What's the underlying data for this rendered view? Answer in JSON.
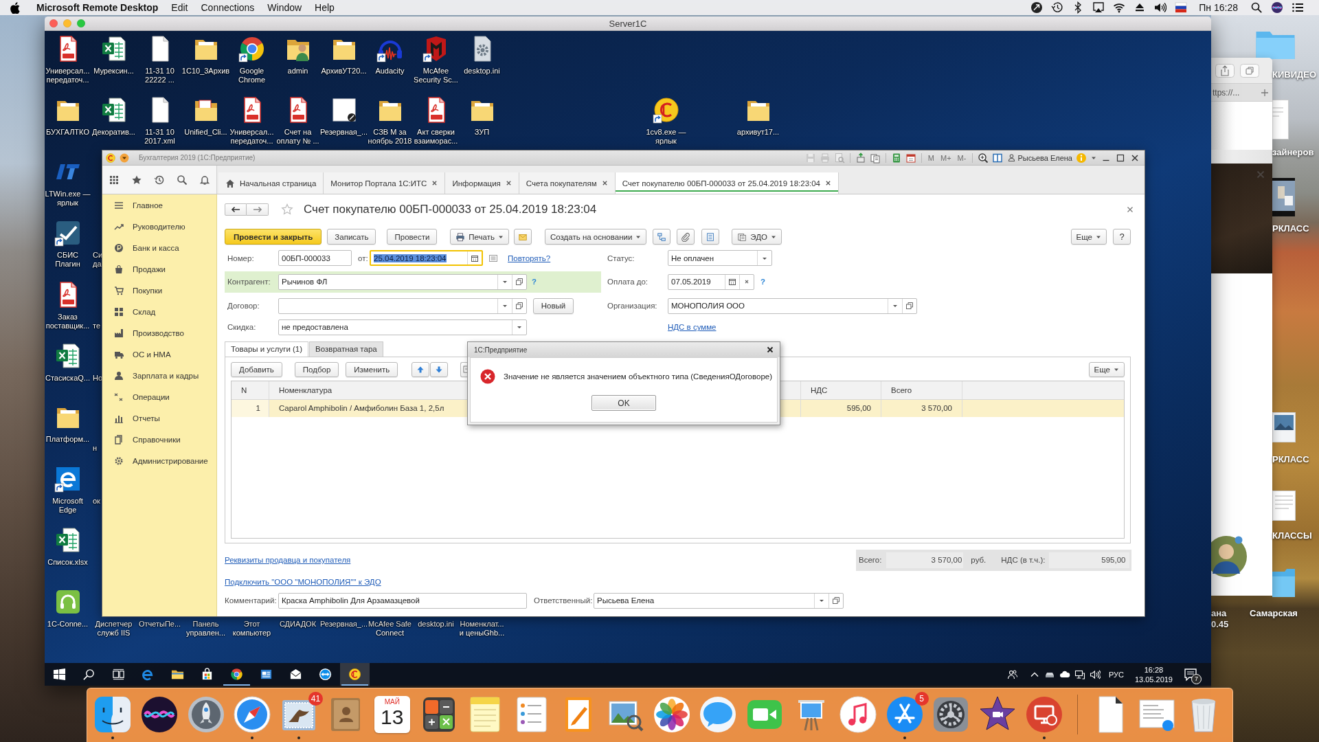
{
  "menu_bar": {
    "app_name": "Microsoft Remote Desktop",
    "menus": [
      "Edit",
      "Connections",
      "Window",
      "Help"
    ],
    "clock": "Пн 16:28"
  },
  "mac_desktop": {
    "browser_address": "ttps://...",
    "labels": [
      "КИВИДЕО",
      "зайнеров",
      "РКЛАСС",
      "РКЛАСС",
      "КЛАССЫ",
      "ана\n0.45",
      "Самарская"
    ]
  },
  "remote_window": {
    "title": "Server1C"
  },
  "remote_desktop": {
    "icons": [
      {
        "label": "Универсал...\nпередаточ...",
        "kind": "pdf",
        "shortcut": false
      },
      {
        "label": "Мурексин...",
        "kind": "excel",
        "shortcut": false
      },
      {
        "label": "11-31 10\n22222 ...",
        "kind": "file",
        "shortcut": false
      },
      {
        "label": "1С10_3Архив",
        "kind": "folder",
        "shortcut": false
      },
      {
        "label": "Google\nChrome",
        "kind": "chrome",
        "shortcut": true
      },
      {
        "label": "admin",
        "kind": "user",
        "shortcut": false
      },
      {
        "label": "АрхивУТ20...",
        "kind": "folder",
        "shortcut": false
      },
      {
        "label": "Audacity",
        "kind": "audio",
        "shortcut": true
      },
      {
        "label": "McAfee\nSecurity Sc...",
        "kind": "mcafee",
        "shortcut": true
      },
      {
        "label": "desktop.ini",
        "kind": "gearfile",
        "shortcut": false
      },
      {
        "label": "БУХГАЛТКО",
        "kind": "folder",
        "shortcut": false
      },
      {
        "label": "Декоратив...",
        "kind": "excel",
        "shortcut": false
      },
      {
        "label": "11-31 10\n2017.xml",
        "kind": "file",
        "shortcut": false
      },
      {
        "label": "Unified_Cli...",
        "kind": "docfolder",
        "shortcut": false
      },
      {
        "label": "Универсал...\nпередаточ...",
        "kind": "pdf",
        "shortcut": false
      },
      {
        "label": "Счет на\nоплату № ...",
        "kind": "pdf",
        "shortcut": false
      },
      {
        "label": "Резервная_...",
        "kind": "image",
        "shortcut": false
      },
      {
        "label": "СЗВ М за\nноябрь 2018",
        "kind": "folder",
        "shortcut": false
      },
      {
        "label": "Акт сверки\nвзаиморас...",
        "kind": "pdf",
        "shortcut": false
      },
      {
        "label": "ЗУП",
        "kind": "folder",
        "shortcut": false
      },
      {
        "label": "1cv8.exe —\nярлык",
        "kind": "onec",
        "shortcut": true
      },
      {
        "label": "архивут17...",
        "kind": "folder",
        "shortcut": false
      },
      {
        "label": "LTWin.exe —\nярлык",
        "kind": "lt",
        "shortcut": false
      },
      {
        "label": "СБИС\nПлагин",
        "kind": "sbis",
        "shortcut": true
      },
      {
        "label": "Заказ\nпоставщик...",
        "kind": "pdf",
        "shortcut": false
      },
      {
        "label": "СтасискаQ...",
        "kind": "excel",
        "shortcut": false
      },
      {
        "label": "Платформ...",
        "kind": "folder",
        "shortcut": false
      },
      {
        "label": "Microsoft\nEdge",
        "kind": "edge",
        "shortcut": true
      },
      {
        "label": "Список.xlsx",
        "kind": "excel",
        "shortcut": false
      },
      {
        "label": "1C-Conne...",
        "kind": "headset",
        "shortcut": false
      }
    ],
    "covered_labels": [
      "Диспетчер\nслужб IIS",
      "ОтчетыПе...",
      "Панель\nуправлен...",
      "Этот\nкомпьютер",
      "СДИАДОК",
      "Резервная_...",
      "McAfee Safe\nConnect",
      "desktop.ini",
      "Номенклат...\nи ценыGhb..."
    ],
    "cut_labels": [
      "Си\nда",
      "те",
      "Но",
      "н",
      "ок"
    ]
  },
  "onec": {
    "title": "Бухгалтерия 2019 (1С:Предприятие)",
    "memory_buttons": [
      {
        "label": "M",
        "disabled": true
      },
      {
        "label": "M+",
        "disabled": true
      },
      {
        "label": "M-",
        "disabled": true
      }
    ],
    "user": "Рысьева Елена",
    "tabs": [
      {
        "label": "Начальная страница",
        "kind": "home",
        "selected": false
      },
      {
        "label": "Монитор Портала 1С:ИТС",
        "kind": "page",
        "selected": false
      },
      {
        "label": "Информация",
        "kind": "page",
        "selected": false
      },
      {
        "label": "Счета покупателям",
        "kind": "page",
        "selected": false
      },
      {
        "label": "Счет покупателю 00БП-000033 от 25.04.2019 18:23:04",
        "kind": "page",
        "selected": true
      }
    ],
    "sidebar": [
      "Главное",
      "Руководителю",
      "Банк и касса",
      "Продажи",
      "Покупки",
      "Склад",
      "Производство",
      "ОС и НМА",
      "Зарплата и кадры",
      "Операции",
      "Отчеты",
      "Справочники",
      "Администрирование"
    ],
    "document": {
      "title": "Счет покупателю 00БП-000033 от 25.04.2019 18:23:04",
      "toolbar": [
        {
          "kind": "primary",
          "label": "Провести и закрыть"
        },
        {
          "kind": "text",
          "label": "Записать"
        },
        {
          "kind": "text",
          "label": "Провести"
        },
        {
          "kind": "menu",
          "label": "Печать"
        },
        {
          "kind": "icon"
        },
        {
          "kind": "menu",
          "label": "Создать на основании"
        },
        {
          "kind": "icon"
        },
        {
          "kind": "icon"
        },
        {
          "kind": "icon"
        },
        {
          "kind": "menu",
          "label": "ЭДО"
        }
      ],
      "toolbar_right": [
        {
          "kind": "menu",
          "label": "Еще"
        },
        {
          "kind": "text",
          "label": "?"
        }
      ],
      "number": {
        "label": "Номер:",
        "value": "00БП-000033"
      },
      "date": {
        "label": "от:",
        "value": "25.04.2019 18:23:04",
        "focused": true
      },
      "repeat_link": "Повторять?",
      "status": {
        "label": "Статус:",
        "value": "Не оплачен"
      },
      "counterparty": {
        "label": "Контрагент:",
        "value": "Рычинов ФЛ",
        "highlighted": true,
        "help": "?"
      },
      "pay_until": {
        "label": "Оплата до:",
        "value": "07.05.2019",
        "help": "?"
      },
      "contract": {
        "label": "Договор:",
        "button": "Новый"
      },
      "organization": {
        "label": "Организация:",
        "value": "МОНОПОЛИЯ ООО"
      },
      "discount": {
        "label": "Скидка:",
        "value": "не предоставлена"
      },
      "vat_link": "НДС в сумме",
      "tabs": [
        {
          "label": "Товары и услуги (1)",
          "selected": true
        },
        {
          "label": "Возвратная тара",
          "selected": false
        }
      ],
      "table_toolbar": [
        "Добавить",
        "Подбор",
        "Изменить"
      ],
      "table_more": "Еще",
      "table": {
        "columns": [
          "N",
          "Номенклатура",
          "НДС",
          "Всего"
        ],
        "rows": [
          {
            "cells": [
              "1",
              "Caparol Amphibolin / Амфиболин База 1, 2,5л",
              "595,00",
              "3 570,00"
            ],
            "selected": true
          }
        ]
      },
      "totals": {
        "total_label": "Всего:",
        "total": "3 570,00",
        "currency": "руб.",
        "vat_label": "НДС (в т.ч.):",
        "vat": "595,00"
      },
      "links": [
        "Реквизиты продавца и покупателя",
        "Подключить \"ООО \"МОНОПОЛИЯ\"\" к ЭДО"
      ],
      "comment": {
        "label": "Комментарий:",
        "value": "Краска Amphibolin Для Арзамазцевой"
      },
      "responsible": {
        "label": "Ответственный:",
        "value": "Рысьева Елена"
      }
    }
  },
  "dialog": {
    "title": "1С:Предприятие",
    "message": "Значение не является значением объектного типа (СведенияОДоговоре)",
    "button": "OK"
  },
  "taskbar": {
    "apps": [
      {
        "kind": "start",
        "running": false,
        "selected": false
      },
      {
        "kind": "search",
        "running": false,
        "selected": false
      },
      {
        "kind": "taskview",
        "running": false,
        "selected": false
      },
      {
        "kind": "edge",
        "running": false,
        "selected": false
      },
      {
        "kind": "explorer",
        "running": false,
        "selected": false
      },
      {
        "kind": "store",
        "running": false,
        "selected": false
      },
      {
        "kind": "chrome",
        "running": true,
        "selected": false
      },
      {
        "kind": "panel",
        "running": false,
        "selected": false
      },
      {
        "kind": "mail",
        "running": false,
        "selected": false
      },
      {
        "kind": "teamviewer",
        "running": false,
        "selected": false
      },
      {
        "kind": "onec",
        "running": true,
        "selected": true
      }
    ],
    "language": "РУС",
    "time": "16:28",
    "date": "13.05.2019",
    "notifications": "7"
  },
  "dock": {
    "apps": [
      {
        "kind": "finder",
        "running": true
      },
      {
        "kind": "siri",
        "running": false
      },
      {
        "kind": "launchpad",
        "running": false
      },
      {
        "kind": "safari",
        "running": true
      },
      {
        "kind": "mail",
        "running": true,
        "badge": "41"
      },
      {
        "kind": "contacts",
        "running": false
      },
      {
        "kind": "calendar",
        "running": false,
        "month": "МАЙ",
        "day": "13"
      },
      {
        "kind": "calculator",
        "running": false
      },
      {
        "kind": "notes",
        "running": false
      },
      {
        "kind": "reminders",
        "running": false
      },
      {
        "kind": "pages",
        "running": false
      },
      {
        "kind": "preview",
        "running": false
      },
      {
        "kind": "photos",
        "running": false
      },
      {
        "kind": "messages",
        "running": false
      },
      {
        "kind": "facetime",
        "running": false
      },
      {
        "kind": "keynote",
        "running": false
      },
      {
        "kind": "music",
        "running": false
      },
      {
        "kind": "appstore",
        "running": true,
        "badge": "5"
      },
      {
        "kind": "settings",
        "running": false
      },
      {
        "kind": "imovie",
        "running": false
      },
      {
        "kind": "remote",
        "running": true
      }
    ],
    "documents": [
      {
        "kind": "document"
      },
      {
        "kind": "screenshot"
      },
      {
        "kind": "trash"
      }
    ]
  }
}
